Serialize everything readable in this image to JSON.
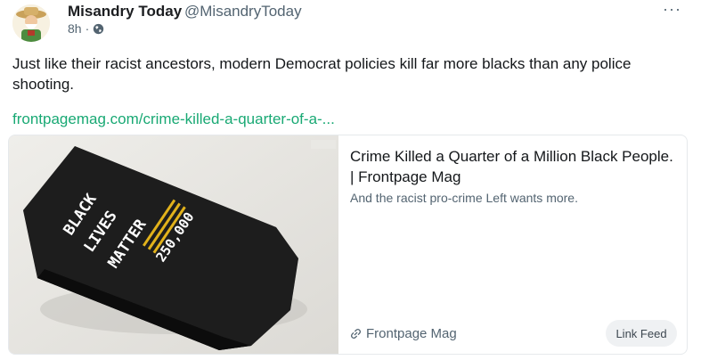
{
  "author": {
    "name": "Misandry Today",
    "handle": "@MisandryToday",
    "time": "8h",
    "separator": "·",
    "visibility_icon": "globe-icon"
  },
  "menu": {
    "more_label": "···"
  },
  "post": {
    "text": "Just like their racist ancestors, modern Democrat policies kill far more blacks than any police shooting.",
    "link_text": "frontpagemag.com/crime-killed-a-quarter-of-a-..."
  },
  "card": {
    "image_text": {
      "line1": "BLACK",
      "line2": "LIVES",
      "line3": "MATTER",
      "number": "250,000"
    },
    "title": "Crime Killed a Quarter of a Million Black People. | Frontpage Mag",
    "description": "And the racist pro-crime Left wants more.",
    "source": "Frontpage Mag",
    "source_icon": "link-icon",
    "feed_button": "Link Feed"
  },
  "colors": {
    "link": "#19a974",
    "text": "#14171a",
    "muted": "#536471",
    "coffin": "#1f1f1f",
    "stripe": "#e2b21b"
  }
}
